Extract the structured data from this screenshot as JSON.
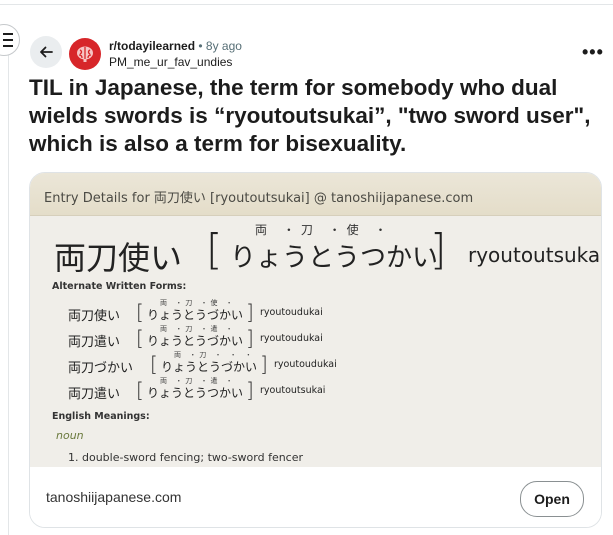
{
  "post": {
    "subreddit": "r/todayilearned",
    "separator": "•",
    "age": "8y ago",
    "author": "PM_me_ur_fav_undies",
    "overflow": "•••",
    "title": "TIL in Japanese, the term for somebody who dual wields swords is “ryoutoutsukai”, \"two sword user\", which is also a term for bisexuality."
  },
  "link_card": {
    "preview": {
      "header": "Entry Details for 両刀使い [ryoutoutsukai] @ tanoshiijapanese.com",
      "main_kanji": "両刀使い",
      "main_ruby": "両 ・刀 ・使 ・",
      "main_kana": "りょうとうつかい",
      "bracket_left": "[",
      "bracket_right": "]",
      "main_romaji": "ryoutoutsuka",
      "alt_label": "Alternate Written Forms:",
      "alt_forms": [
        {
          "kanji": "両刀使い",
          "ruby": "両 ・刀 ・使 ・",
          "kana": "りょうとうづかい",
          "romaji": "ryoutoudukai"
        },
        {
          "kanji": "両刀遣い",
          "ruby": "両 ・刀 ・遣 ・",
          "kana": "りょうとうづかい",
          "romaji": "ryoutoudukai"
        },
        {
          "kanji": "両刀づかい",
          "ruby": "両 ・刀 ・ ・ ・",
          "kana": "りょうとうづかい",
          "romaji": "ryoutoudukai"
        },
        {
          "kanji": "両刀遣い",
          "ruby": "両 ・刀 ・遣 ・",
          "kana": "りょうとうつかい",
          "romaji": "ryoutoutsukai"
        }
      ],
      "meanings_label": "English Meanings:",
      "part_of_speech": "noun",
      "meaning_1": "1. double-sword fencing; two-sword fencer"
    },
    "domain": "tanoshiijapanese.com",
    "open_label": "Open"
  },
  "icons": {
    "menu": "hamburger-icon",
    "back": "arrow-left-icon",
    "avatar": "brain-icon"
  },
  "colors": {
    "avatar_bg": "#d7262a",
    "preview_bg": "#f0eee9",
    "pos_color": "#6b7a3e"
  }
}
